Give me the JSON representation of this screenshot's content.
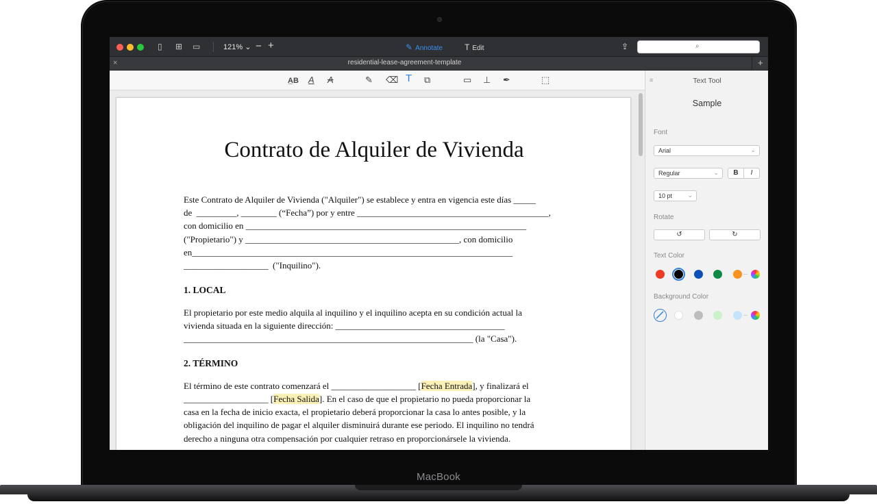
{
  "device": {
    "brand": "MacBook"
  },
  "toolbar": {
    "zoom": "121% ⌄",
    "zoom_minus": "−",
    "zoom_plus": "+",
    "annotate_label": "Annotate",
    "edit_label": "Edit",
    "accent_color": "#3a8ef0"
  },
  "tab": {
    "title": "residential-lease-agreement-template",
    "close": "×",
    "add": "+"
  },
  "document": {
    "title": "Contrato de Alquiler de Vivienda",
    "intro": [
      "Este Contrato de Alquiler de Vivienda (\"Alquiler\") se establece y entra en vigencia este días _____",
      "de  _________, ________ (“Fecha”) por y entre ___________________________________________,",
      "con domicilio en _______________________________________________________________",
      "(\"Propietario\") y ________________________________________________, con domicilio",
      "en________________________________________________________________________",
      "___________________  (\"Inquilino\")."
    ],
    "section1_heading": "1. LOCAL",
    "section1": [
      "El propietario por este medio alquila al inquilino y el inquilino acepta en su condición actual la",
      "vivienda situada en la siguiente dirección: ______________________________________",
      "_________________________________________________________________ (la \"Casa\")."
    ],
    "section2_heading": "2. TÉRMINO",
    "section2": {
      "line1_a": "El término de este contrato comenzará el ___________________ [",
      "line1_hl": "Fecha Entrada",
      "line1_b": "], y finalizará el",
      "line2_a": "___________________ [",
      "line2_hl": "Fecha Salida",
      "line2_b": "]. En el caso de que el propietario no pueda proporcionar la",
      "rest": [
        "casa en la fecha de inicio exacta, el propietario deberá proporcionar la casa lo antes posible, y la",
        "obligación del inquilino de pagar el alquiler disminuirá durante ese periodo. El inquilino no tendrá",
        "derecho a ninguna otra compensación por cualquier retraso en proporcionársele la vivienda."
      ]
    },
    "highlight_color": "#fbf0b6"
  },
  "inspector": {
    "title": "Text Tool",
    "sample": "Sample",
    "font_label": "Font",
    "font_value": "Arial",
    "style_value": "Regular",
    "bold": "B",
    "italic": "I",
    "size_value": "10 pt",
    "rotate_label": "Rotate",
    "rotate_left": "↺",
    "rotate_right": "↻",
    "text_color_label": "Text Color",
    "text_colors": [
      "#ee3a24",
      "#000000",
      "#0e4fb8",
      "#0e8a44",
      "#f7931e"
    ],
    "selected_text_color": "#000000",
    "background_color_label": "Background Color",
    "background_colors": [
      "#ffffff",
      "#bdbdbd",
      "#c9f2c9",
      "#c5e3fb"
    ]
  }
}
